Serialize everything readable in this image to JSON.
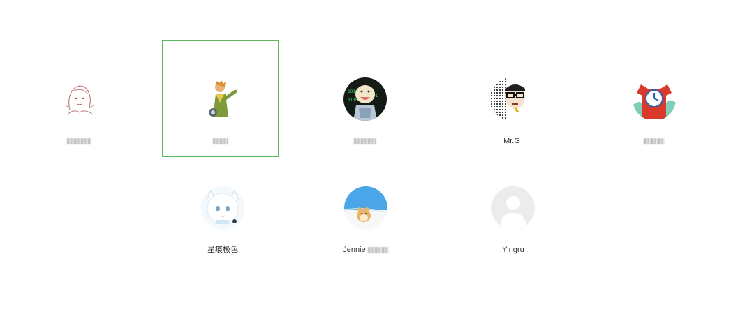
{
  "contacts": [
    {
      "name": "",
      "selected": false,
      "avatar_icon": "sketch-girl-avatar-icon"
    },
    {
      "name": "",
      "selected": true,
      "avatar_icon": "little-prince-avatar-icon",
      "highlight_color": "#5cb85c"
    },
    {
      "name": "",
      "selected": false,
      "avatar_icon": "cartoon-character-avatar-icon"
    },
    {
      "name": "Mr.G",
      "selected": false,
      "avatar_icon": "glasses-man-avatar-icon"
    },
    {
      "name": "",
      "selected": false,
      "avatar_icon": "red-clock-avatar-icon"
    },
    {
      "name": "星痕极色",
      "selected": false,
      "avatar_icon": "white-anime-girl-avatar-icon"
    },
    {
      "name": "Jennie",
      "selected": false,
      "avatar_icon": "hamster-avatar-icon"
    },
    {
      "name": "Yingru",
      "selected": false,
      "avatar_icon": "default-person-avatar-icon"
    }
  ]
}
